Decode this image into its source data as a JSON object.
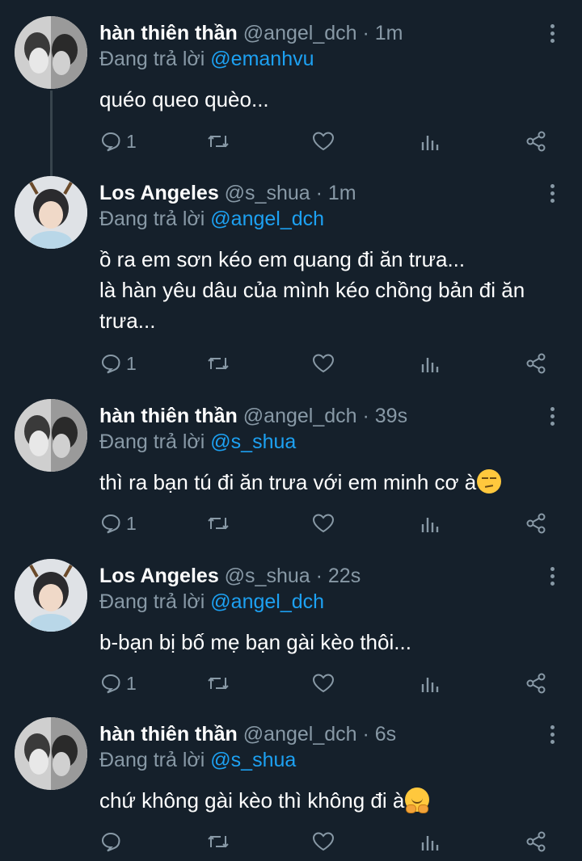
{
  "tweets": [
    {
      "display_name": "hàn thiên thần",
      "handle": "@angel_dch",
      "time": "1m",
      "reply_prefix": "Đang trả lời",
      "reply_to": "@emanhvu",
      "text_lines": [
        "quéo queo quèo..."
      ],
      "emoji": "",
      "reply_count": "1",
      "avatar": "avatar-a"
    },
    {
      "display_name": "Los Angeles",
      "handle": "@s_shua",
      "time": "1m",
      "reply_prefix": "Đang trả lời",
      "reply_to": "@angel_dch",
      "text_lines": [
        "ồ ra em sơn kéo em quang đi ăn trưa...",
        "là hàn yêu dâu của mình kéo chồng bản đi ăn",
        "trưa..."
      ],
      "emoji": "",
      "reply_count": "1",
      "avatar": "avatar-b"
    },
    {
      "display_name": "hàn thiên thần",
      "handle": "@angel_dch",
      "time": "39s",
      "reply_prefix": "Đang trả lời",
      "reply_to": "@s_shua",
      "text_lines": [
        "thì ra bạn tú đi ăn trưa với em minh cơ à"
      ],
      "emoji": "unamused-face",
      "reply_count": "1",
      "avatar": "avatar-a"
    },
    {
      "display_name": "Los Angeles",
      "handle": "@s_shua",
      "time": "22s",
      "reply_prefix": "Đang trả lời",
      "reply_to": "@angel_dch",
      "text_lines": [
        "b-bạn bị bố mẹ bạn gài kèo thôi..."
      ],
      "emoji": "",
      "reply_count": "1",
      "avatar": "avatar-b"
    },
    {
      "display_name": "hàn thiên thần",
      "handle": "@angel_dch",
      "time": "6s",
      "reply_prefix": "Đang trả lời",
      "reply_to": "@s_shua",
      "text_lines": [
        "chứ không gài kèo thì không đi à"
      ],
      "emoji": "hugging-face",
      "reply_count": "",
      "avatar": "avatar-a"
    }
  ],
  "separator": "·",
  "colors": {
    "background": "#15202b",
    "text": "#ffffff",
    "secondary": "#8899a6",
    "link": "#1da1f2",
    "thread_line": "#38444d"
  },
  "icons": [
    "reply-icon",
    "retweet-icon",
    "like-icon",
    "analytics-icon",
    "share-icon",
    "more-options-icon"
  ]
}
